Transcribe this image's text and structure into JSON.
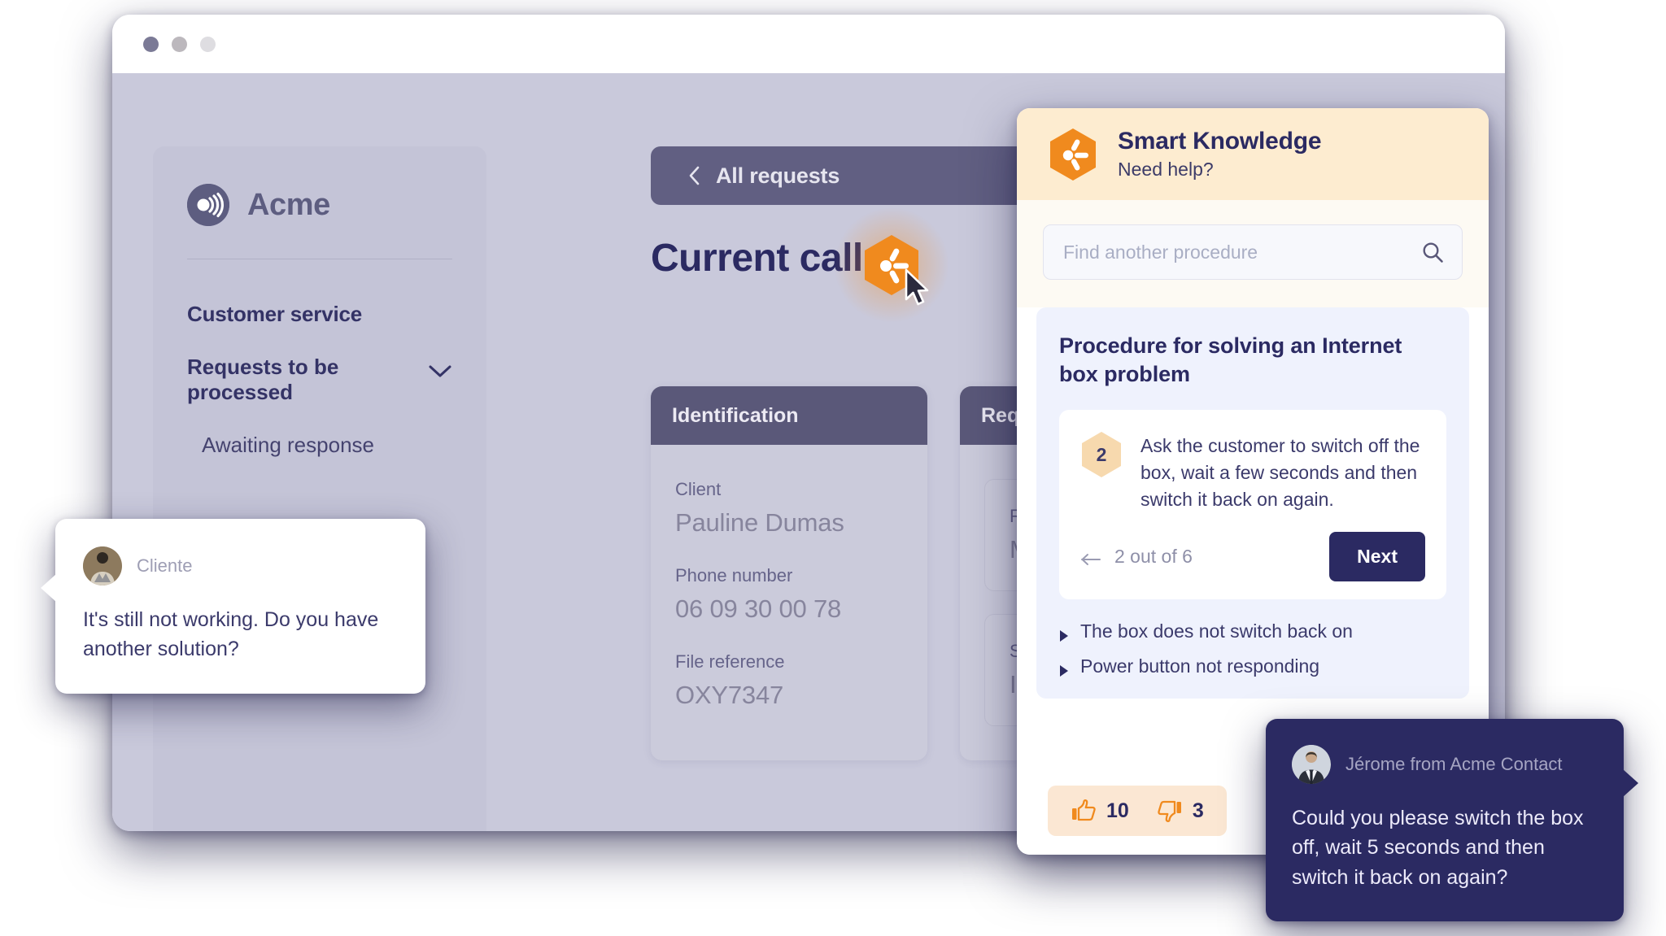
{
  "browser": {
    "window_controls": [
      "close-dot",
      "minimize-dot",
      "maximize-dot"
    ]
  },
  "sidebar": {
    "brand": {
      "name": "Acme",
      "logo_icon": "acme-signal-logo"
    },
    "nav_heading": "Customer service",
    "group": {
      "label": "Requests to be processed",
      "chevron_icon": "chevron-down-icon"
    },
    "sub_items": [
      {
        "label": "Awaiting response"
      }
    ]
  },
  "main": {
    "back_bar": {
      "label": "All requests",
      "icon": "chevron-left-icon"
    },
    "page_title": "Current call",
    "launcher": {
      "icon": "smart-knowledge-hexagon-icon",
      "cursor": "mouse-pointer-icon"
    },
    "cards": [
      {
        "header": "Identification",
        "fields": [
          {
            "label": "Client",
            "value": "Pauline Dumas"
          },
          {
            "label": "Phone number",
            "value": "06 09 30 00 78"
          },
          {
            "label": "File reference",
            "value": "OXY7347"
          }
        ]
      },
      {
        "header": "Request",
        "fields": [
          {
            "label": "Reason for request",
            "value": "My appliance"
          },
          {
            "label": "Subject",
            "value": "Internet box"
          }
        ]
      }
    ]
  },
  "smart_knowledge": {
    "title": "Smart Knowledge",
    "subtitle": "Need help?",
    "logo_icon": "smart-knowledge-hexagon-icon",
    "search": {
      "placeholder": "Find another procedure",
      "value": "",
      "icon": "search-icon"
    },
    "procedure": {
      "title": "Procedure for solving an Internet box problem",
      "step_number": "2",
      "step_text": "Ask the customer to switch off the box, wait a few seconds and then switch it back on again.",
      "progress_label": "2 out of 6",
      "back_icon": "arrow-left-icon",
      "next_label": "Next"
    },
    "related_items": [
      {
        "label": "The box does not switch back on",
        "icon": "triangle-right-icon"
      },
      {
        "label": "Power button not responding",
        "icon": "triangle-right-icon"
      }
    ],
    "feedback": {
      "up_icon": "thumbs-up-icon",
      "up_count": "10",
      "down_icon": "thumbs-down-icon",
      "down_count": "3"
    }
  },
  "chat": {
    "client_message": {
      "author": "Cliente",
      "text": "It's still not working. Do you have another solution?",
      "avatar": "client-avatar"
    },
    "agent_message": {
      "author": "Jérome from Acme Contact",
      "text": "Could you please switch the box off, wait 5 seconds and then switch it back on again?",
      "avatar": "agent-avatar"
    }
  },
  "colors": {
    "brand_orange": "#f38d20",
    "deep_navy": "#2b2a62",
    "panel_cream": "#fdecd0",
    "app_bg": "#c9c9db",
    "card_header": "#5a5879"
  }
}
